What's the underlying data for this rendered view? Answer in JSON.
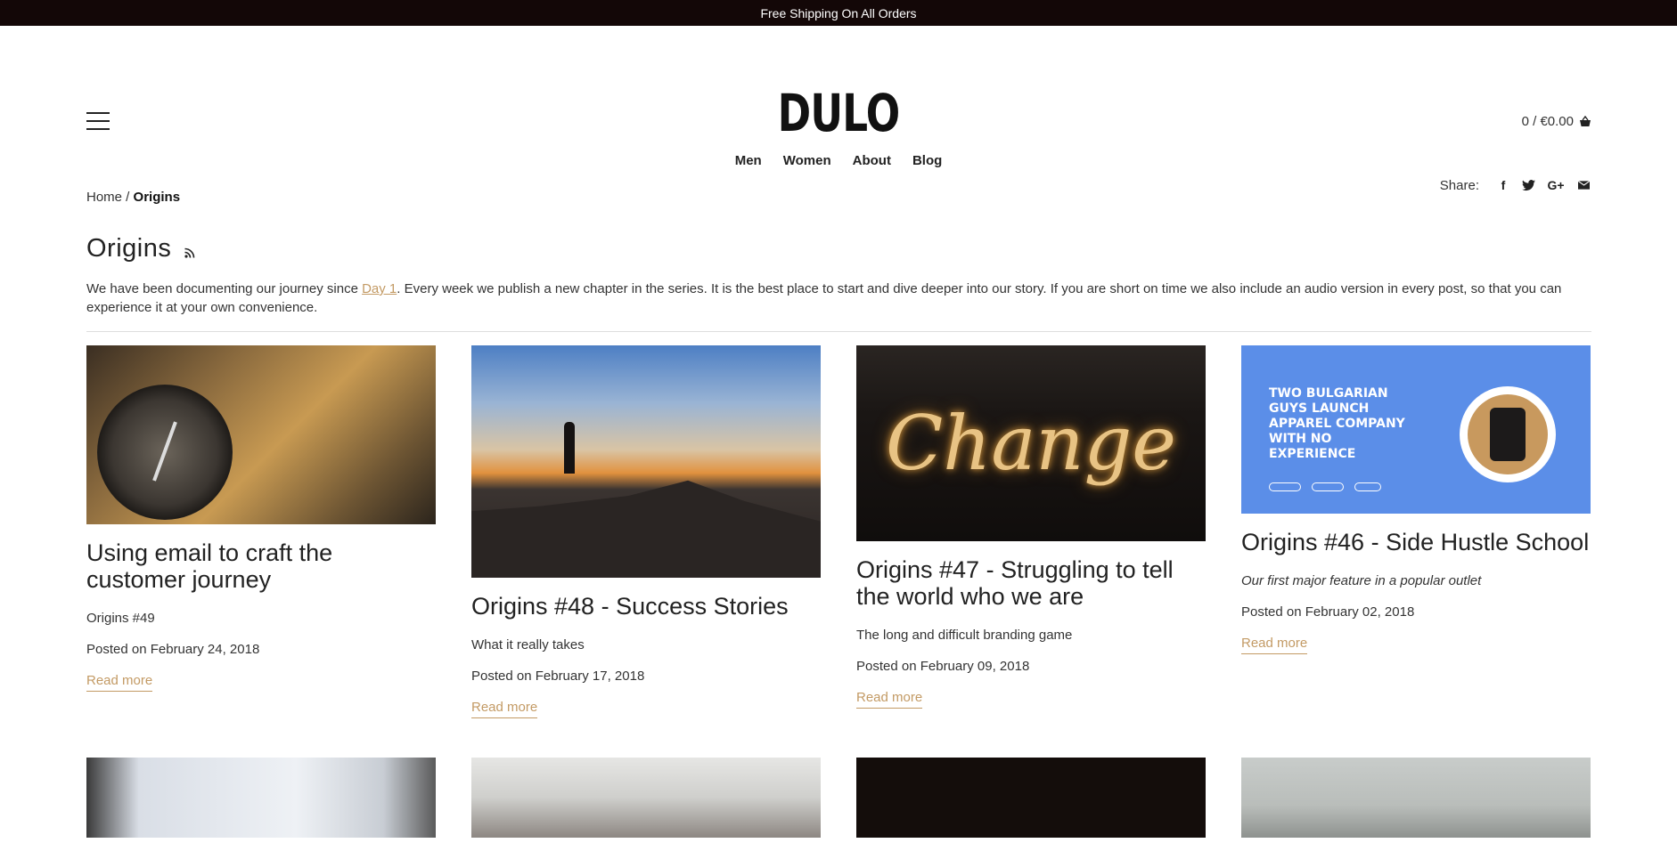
{
  "announcement": "Free Shipping On All Orders",
  "brand": "DULO",
  "cart": {
    "label": "0 / €0.00",
    "icon": "basket-icon"
  },
  "nav": [
    "Men",
    "Women",
    "About",
    "Blog"
  ],
  "breadcrumb": {
    "home": "Home",
    "separator": " / ",
    "current": "Origins"
  },
  "share": {
    "label": "Share:",
    "icons": [
      "facebook-icon",
      "twitter-icon",
      "google-plus-icon",
      "email-icon"
    ]
  },
  "page": {
    "title": "Origins",
    "desc_before": "We have been documenting our journey since ",
    "desc_link": "Day 1",
    "desc_after": ". Every week we publish a new chapter in the series. It is the best place to start and dive deeper into our story. If you are short on time we also include an audio version in every post, so that you can experience it at your own convenience."
  },
  "posts": [
    {
      "title": "Using email to craft the customer journey",
      "subtitle": "Origins #49",
      "date": "Posted on February 24, 2018",
      "read_more": "Read more"
    },
    {
      "title": "Origins #48 - Success Stories",
      "subtitle": "What it really takes",
      "date": "Posted on February 17, 2018",
      "read_more": "Read more"
    },
    {
      "title": "Origins #47 - Struggling to tell the world who we are",
      "subtitle": "The long and difficult branding game",
      "date": "Posted on February 09, 2018",
      "read_more": "Read more"
    },
    {
      "title": "Origins #46 - Side Hustle School",
      "subtitle": "Our first major feature in a popular outlet",
      "date": "Posted on February 02, 2018",
      "read_more": "Read more"
    }
  ],
  "feature_image": {
    "headline": "TWO BULGARIAN GUYS LAUNCH APPAREL COMPANY WITH NO EXPERIENCE",
    "image_text": "Change"
  },
  "colors": {
    "accent": "#c39a64",
    "topbar": "#130707",
    "feature_bg": "#5b8ee8"
  }
}
